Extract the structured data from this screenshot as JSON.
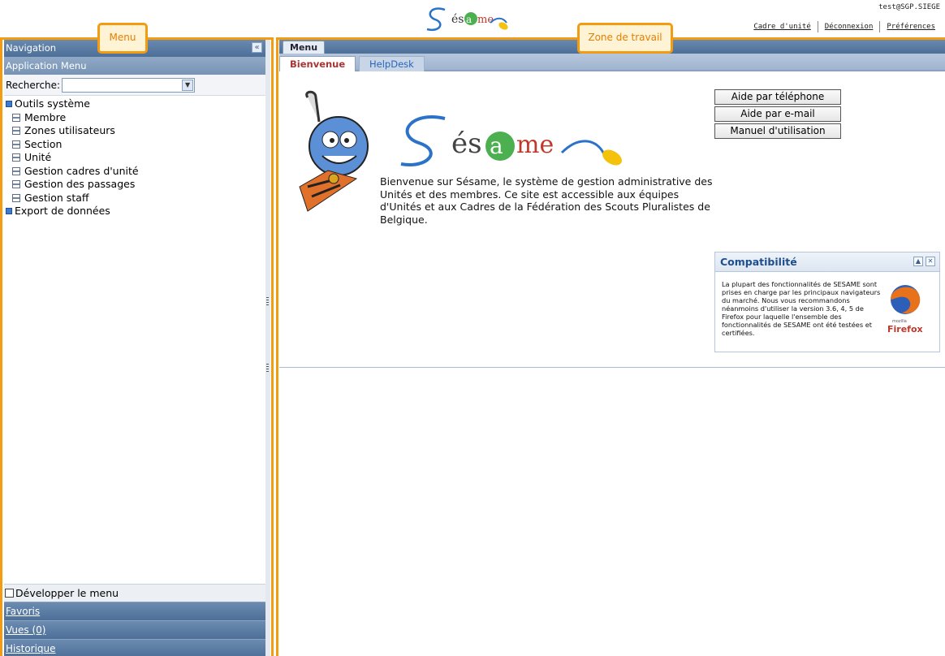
{
  "header": {
    "logo_text": "Sésame",
    "user": "test@SGP.SIEGE",
    "links": [
      "Cadre d'unité",
      "Déconnexion",
      "Préférences"
    ]
  },
  "left_panel": {
    "navigation_label": "Navigation",
    "collapse_icon": "«",
    "app_menu_label": "Application Menu",
    "search_label": "Recherche:",
    "search_value": "",
    "tree": {
      "root1": "Outils système",
      "children": [
        "Membre",
        "Zones utilisateurs",
        "Section",
        "Unité",
        "Gestion cadres d'unité",
        "Gestion des passages",
        "Gestion staff"
      ],
      "root2": "Export de données"
    },
    "expand_label": "Développer le menu",
    "bottom_links": [
      "Favoris",
      "Vues (0)",
      "Historique"
    ]
  },
  "workspace": {
    "menu_tab": "Menu",
    "tabs": [
      "Bienvenue",
      "HelpDesk"
    ],
    "logo_text": "Sésame",
    "welcome_text": "Bienvenue sur Sésame, le système de gestion administrative des Unités et des membres. Ce site est accessible aux équipes d'Unités et aux Cadres de la Fédération des Scouts Pluralistes de Belgique.",
    "buttons": [
      "Aide par téléphone",
      "Aide par e-mail",
      "Manuel d'utilisation"
    ],
    "compat": {
      "title": "Compatibilité",
      "body": "La plupart des fonctionnalités de SESAME sont prises en charge par les principaux navigateurs du marché. Nous vous recommandons néanmoins d'utiliser la version 3.6, 4, 5 de Firefox pour laquelle l'ensemble des fonctionnalités de SESAME ont été testées et certifiées.",
      "ff_small": "mozilla",
      "ff_brand": "Firefox"
    }
  },
  "callouts": {
    "menu": "Menu",
    "zone": "Zone de travail"
  },
  "colors": {
    "accent_orange": "#f39c12",
    "bar_blue": "#4d6f98",
    "tab_active_text": "#a33333"
  }
}
